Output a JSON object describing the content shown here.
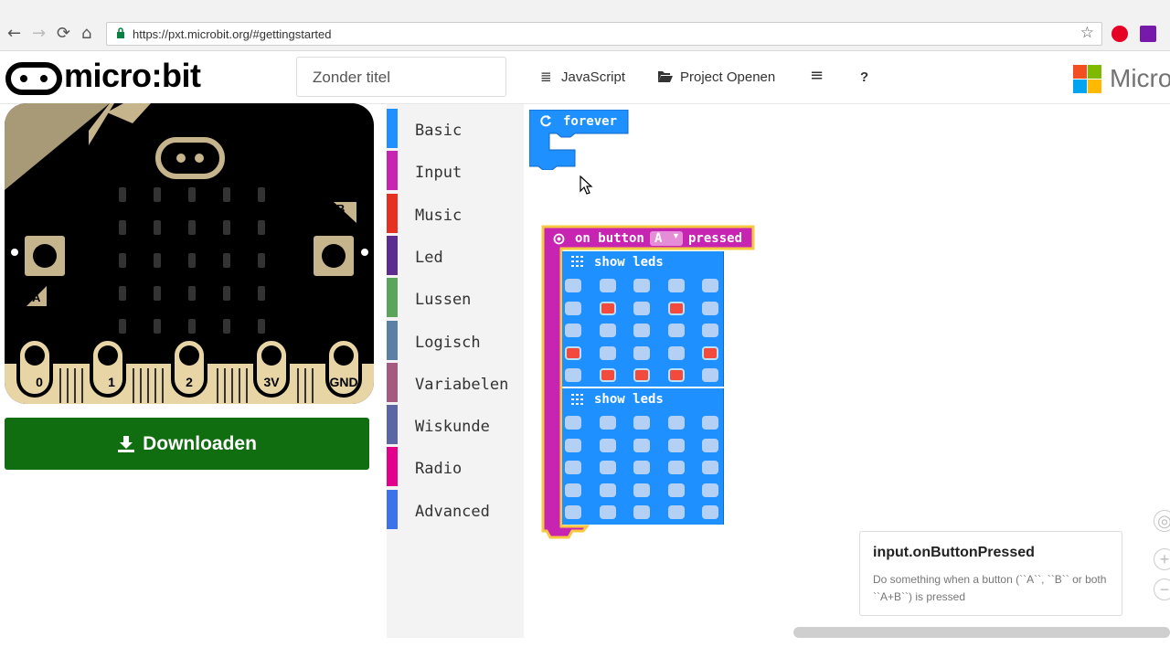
{
  "browser": {
    "url": "https://pxt.microbit.org/#gettingstarted",
    "back_icon": "←",
    "forward_icon": "→",
    "reload_icon": "⟳",
    "home_icon": "⌂",
    "star_icon": "☆"
  },
  "topbar": {
    "logo": "micro:bit",
    "project_name": "Zonder titel",
    "javascript_label": "JavaScript",
    "open_project_label": "Project Openen",
    "menu_icon": "≡",
    "help_label": "?",
    "brand_text": "Micro"
  },
  "simulator": {
    "pins": [
      "0",
      "1",
      "2",
      "3V",
      "GND"
    ],
    "button_a": "A",
    "button_b": "B"
  },
  "download_label": "Downloaden",
  "toolbox": {
    "categories": [
      {
        "label": "Basic",
        "color": "#1e90ff"
      },
      {
        "label": "Input",
        "color": "#c724b1"
      },
      {
        "label": "Music",
        "color": "#e63022"
      },
      {
        "label": "Led",
        "color": "#5c2d91"
      },
      {
        "label": "Lussen",
        "color": "#5ba55b"
      },
      {
        "label": "Logisch",
        "color": "#5b80a5"
      },
      {
        "label": "Variabelen",
        "color": "#a55b80"
      },
      {
        "label": "Wiskunde",
        "color": "#5b67a5"
      },
      {
        "label": "Radio",
        "color": "#e3008c"
      },
      {
        "label": "Advanced",
        "color": "#3c73ea"
      }
    ]
  },
  "blocks": {
    "forever_label": "forever",
    "on_button_label": "on button",
    "button_value": "A",
    "pressed_label": "pressed",
    "show_leds_label": "show leds",
    "colors": {
      "basic": "#1e90ff",
      "input": "#c724b1",
      "outline": "#f7c942"
    },
    "leds_1": [
      [
        0,
        0,
        0,
        0,
        0
      ],
      [
        0,
        1,
        0,
        1,
        0
      ],
      [
        0,
        0,
        0,
        0,
        0
      ],
      [
        1,
        0,
        0,
        0,
        1
      ],
      [
        0,
        1,
        1,
        1,
        0
      ]
    ],
    "leds_2": [
      [
        0,
        0,
        0,
        0,
        0
      ],
      [
        0,
        0,
        0,
        0,
        0
      ],
      [
        0,
        0,
        0,
        0,
        0
      ],
      [
        0,
        0,
        0,
        0,
        0
      ],
      [
        0,
        0,
        0,
        0,
        0
      ]
    ]
  },
  "tooltip": {
    "title": "input.onButtonPressed",
    "description": "Do something when a button (``A``, ``B`` or both ``A+B``) is pressed"
  }
}
